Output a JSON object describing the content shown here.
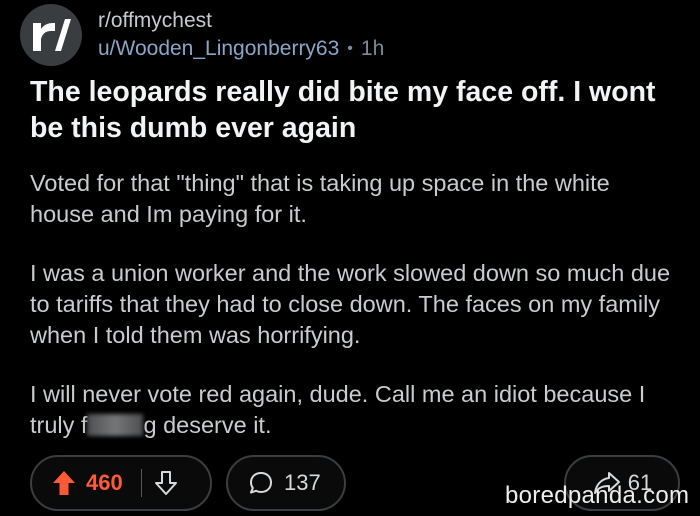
{
  "post": {
    "subreddit": "r/offmychest",
    "username": "u/Wooden_Lingonberry63",
    "separator": "•",
    "time_ago": "1h",
    "title": "The leopards really did bite my face off. I wont be this dumb ever again",
    "paragraphs": [
      "Voted for that \"thing\" that is taking up space in the white house and Im paying for it.",
      "I was a union worker and the work slowed down so much due to tariffs that they had to close down. The faces on my family when I told them was horrifying."
    ],
    "last_paragraph_start": "I will never vote red again, dude. Call me an idiot because I truly f",
    "last_paragraph_end": "g deserve it."
  },
  "actions": {
    "upvote_count": "460",
    "comment_count": "137",
    "share_count": "61"
  },
  "watermark": "boredpanda.com",
  "colors": {
    "background": "#000000",
    "upvote_active": "#ff5a36",
    "link_blue": "#8aa6c7"
  },
  "icons": {
    "avatar": "subreddit-logo-icon",
    "upvote": "upvote-arrow-icon",
    "downvote": "downvote-arrow-icon",
    "comment": "comment-bubble-icon",
    "share": "share-arrow-icon"
  }
}
